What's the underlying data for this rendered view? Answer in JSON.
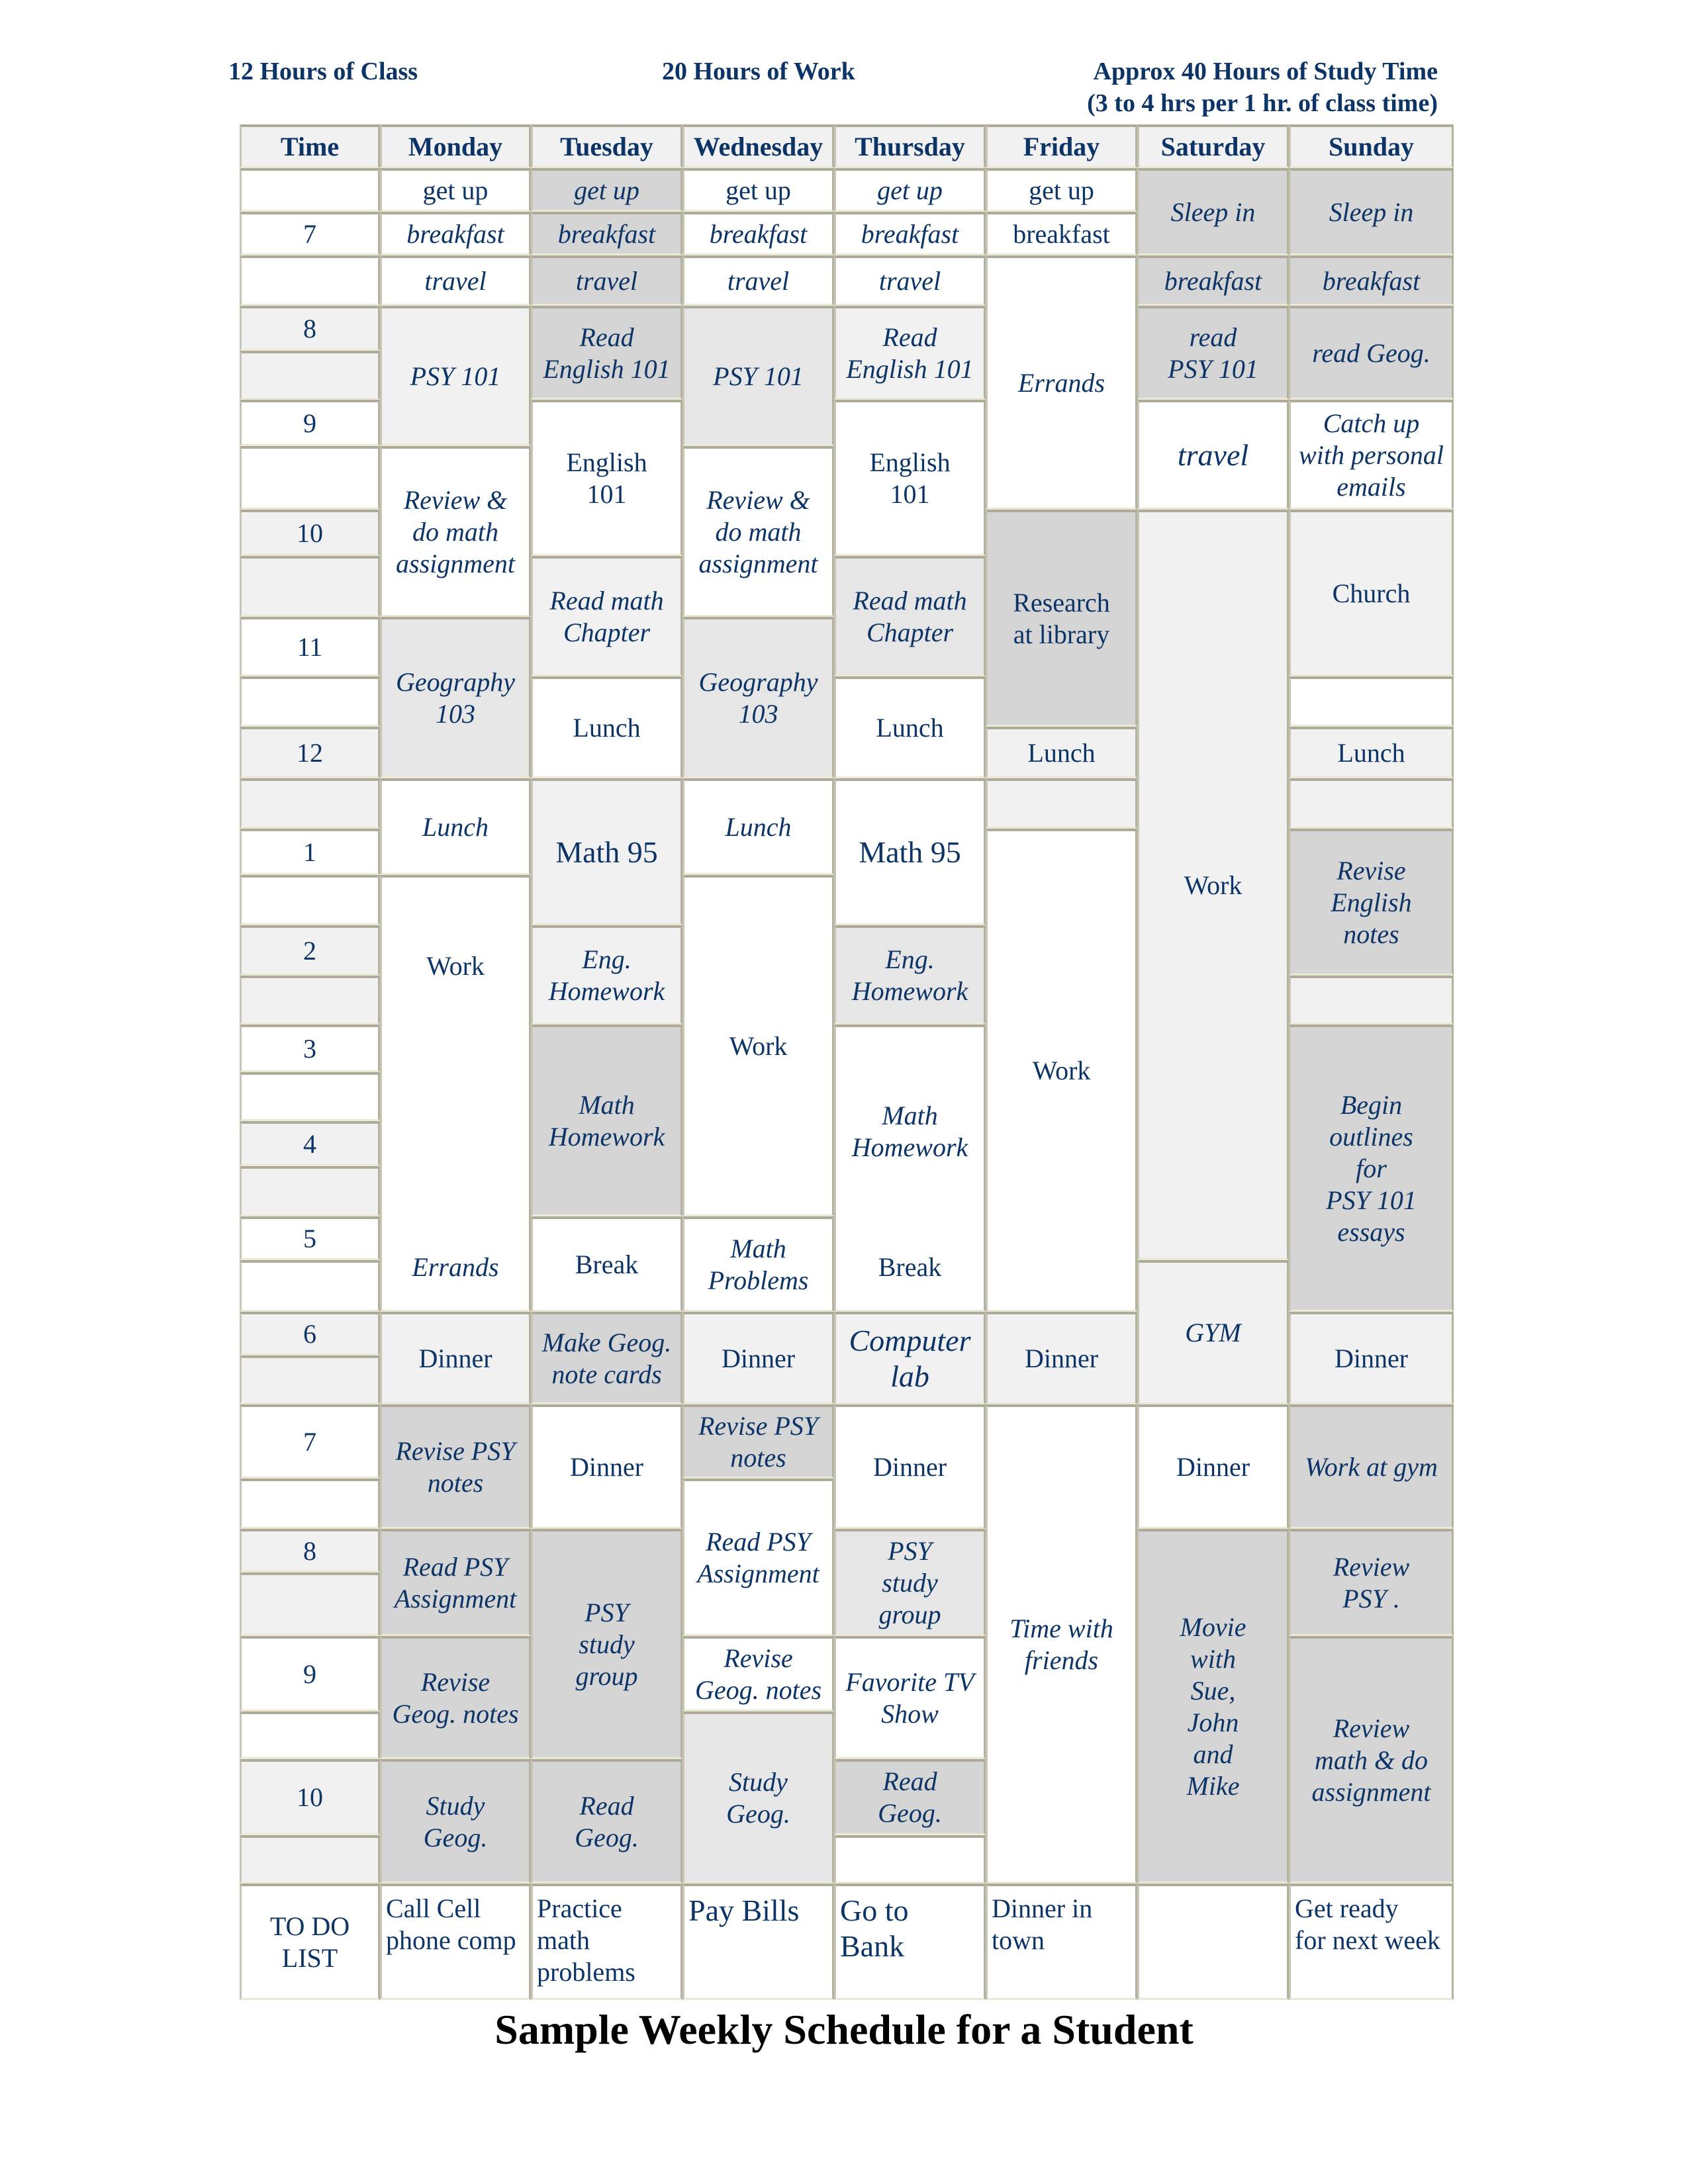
{
  "header_notes": {
    "class_hours": "12 Hours of Class",
    "work_hours": "20 Hours of Work",
    "study_hours_line1": "Approx 40 Hours of Study Time",
    "study_hours_line2": "(3 to 4 hrs per 1 hr. of class time)"
  },
  "columns": [
    "Time",
    "Monday",
    "Tuesday",
    "Wednesday",
    "Thursday",
    "Friday",
    "Saturday",
    "Sunday"
  ],
  "time_labels": [
    "",
    "7",
    "",
    "8",
    "",
    "9",
    "",
    "10",
    "",
    "11",
    "",
    "12",
    "",
    "1",
    "",
    "2",
    "",
    "3",
    "",
    "4",
    "",
    "5",
    "",
    "6",
    "",
    "7",
    "",
    "8",
    "",
    "9",
    "",
    "10",
    ""
  ],
  "time_fills": [
    "white",
    "white",
    "white",
    "light",
    "light",
    "white",
    "white",
    "light",
    "light",
    "white",
    "white",
    "light",
    "light",
    "white",
    "white",
    "light",
    "light",
    "white",
    "white",
    "light",
    "light",
    "white",
    "white",
    "light",
    "light",
    "white",
    "white",
    "light",
    "light",
    "white",
    "white",
    "light",
    "light"
  ],
  "days": [
    {
      "day": "Monday",
      "blocks": [
        {
          "start": 0,
          "span": 1,
          "text": "get up",
          "fill": "white",
          "italic": false
        },
        {
          "start": 1,
          "span": 1,
          "text": "breakfast",
          "fill": "white",
          "italic": true
        },
        {
          "start": 2,
          "span": 1,
          "text": "travel",
          "fill": "white",
          "italic": true
        },
        {
          "start": 3,
          "span": 3,
          "text": "PSY 101",
          "fill": "light",
          "italic": true
        },
        {
          "start": 6,
          "span": 3,
          "text": "Review &\ndo math\nassignment",
          "fill": "white",
          "italic": true
        },
        {
          "start": 9,
          "span": 3,
          "text": "Geography\n103",
          "fill": "mid",
          "italic": true
        },
        {
          "start": 12,
          "span": 2,
          "text": "Lunch",
          "fill": "white",
          "italic": true
        },
        {
          "start": 14,
          "span": 9,
          "text": "Work",
          "text2": "Errands",
          "fill": "white",
          "italic": false,
          "italic2": true
        },
        {
          "start": 23,
          "span": 2,
          "text": "Dinner",
          "fill": "light",
          "italic": false
        },
        {
          "start": 25,
          "span": 2,
          "text": "Revise PSY\nnotes",
          "fill": "dark",
          "italic": true
        },
        {
          "start": 27,
          "span": 2,
          "text": "Read PSY\nAssignment",
          "fill": "dark",
          "italic": true
        },
        {
          "start": 29,
          "span": 2,
          "text": "Revise\nGeog. notes",
          "fill": "dark",
          "italic": true
        },
        {
          "start": 31,
          "span": 2,
          "text": "Study\nGeog.",
          "fill": "dark",
          "italic": true
        }
      ]
    },
    {
      "day": "Tuesday",
      "blocks": [
        {
          "start": 0,
          "span": 1,
          "text": "get up",
          "fill": "dark",
          "italic": true
        },
        {
          "start": 1,
          "span": 1,
          "text": "breakfast",
          "fill": "dark",
          "italic": true
        },
        {
          "start": 2,
          "span": 1,
          "text": "travel",
          "fill": "dark",
          "italic": true
        },
        {
          "start": 3,
          "span": 2,
          "text": "Read\nEnglish 101",
          "fill": "dark",
          "italic": true
        },
        {
          "start": 5,
          "span": 3,
          "text": "English\n101",
          "fill": "white",
          "italic": false
        },
        {
          "start": 8,
          "span": 2,
          "text": "Read math\nChapter",
          "fill": "light",
          "italic": true
        },
        {
          "start": 10,
          "span": 2,
          "text": "Lunch",
          "fill": "white",
          "italic": false
        },
        {
          "start": 12,
          "span": 3,
          "text": "Math 95",
          "fill": "light",
          "italic": false,
          "big": true
        },
        {
          "start": 15,
          "span": 2,
          "text": "Eng.\nHomework",
          "fill": "light",
          "italic": true
        },
        {
          "start": 17,
          "span": 4,
          "text": "Math\nHomework",
          "fill": "dark",
          "italic": true
        },
        {
          "start": 21,
          "span": 2,
          "text": "Break",
          "fill": "white",
          "italic": false
        },
        {
          "start": 23,
          "span": 2,
          "text": "Make Geog.\nnote cards",
          "fill": "dark",
          "italic": true
        },
        {
          "start": 25,
          "span": 2,
          "text": "Dinner",
          "fill": "white",
          "italic": false
        },
        {
          "start": 27,
          "span": 4,
          "text": "PSY\nstudy\ngroup",
          "fill": "dark",
          "italic": true
        },
        {
          "start": 31,
          "span": 2,
          "text": "Read\nGeog.",
          "fill": "dark",
          "italic": true
        }
      ]
    },
    {
      "day": "Wednesday",
      "blocks": [
        {
          "start": 0,
          "span": 1,
          "text": "get up",
          "fill": "white",
          "italic": false
        },
        {
          "start": 1,
          "span": 1,
          "text": "breakfast",
          "fill": "white",
          "italic": true
        },
        {
          "start": 2,
          "span": 1,
          "text": "travel",
          "fill": "white",
          "italic": true
        },
        {
          "start": 3,
          "span": 3,
          "text": "PSY 101",
          "fill": "mid",
          "italic": true
        },
        {
          "start": 6,
          "span": 3,
          "text": "Review &\ndo math\nassignment",
          "fill": "white",
          "italic": true
        },
        {
          "start": 9,
          "span": 3,
          "text": "Geography\n103",
          "fill": "mid",
          "italic": true
        },
        {
          "start": 12,
          "span": 2,
          "text": "Lunch",
          "fill": "white",
          "italic": true
        },
        {
          "start": 14,
          "span": 7,
          "text": "Work",
          "fill": "white",
          "italic": false
        },
        {
          "start": 21,
          "span": 2,
          "text": "Math\nProblems",
          "fill": "white",
          "italic": true
        },
        {
          "start": 23,
          "span": 2,
          "text": "Dinner",
          "fill": "light",
          "italic": false
        },
        {
          "start": 25,
          "span": 1,
          "text": "Revise PSY\nnotes",
          "fill": "dark",
          "italic": true
        },
        {
          "start": 26,
          "span": 3,
          "text": "Read PSY\nAssignment",
          "fill": "white",
          "italic": true
        },
        {
          "start": 29,
          "span": 1,
          "text": "Revise\nGeog. notes",
          "fill": "white",
          "italic": true
        },
        {
          "start": 30,
          "span": 3,
          "text": "Study\nGeog.",
          "fill": "mid",
          "italic": true
        }
      ]
    },
    {
      "day": "Thursday",
      "blocks": [
        {
          "start": 0,
          "span": 1,
          "text": "get up",
          "fill": "white",
          "italic": true
        },
        {
          "start": 1,
          "span": 1,
          "text": "breakfast",
          "fill": "white",
          "italic": true
        },
        {
          "start": 2,
          "span": 1,
          "text": "travel",
          "fill": "white",
          "italic": true
        },
        {
          "start": 3,
          "span": 2,
          "text": "Read\nEnglish 101",
          "fill": "light",
          "italic": true
        },
        {
          "start": 5,
          "span": 3,
          "text": "English\n101",
          "fill": "white",
          "italic": false
        },
        {
          "start": 8,
          "span": 2,
          "text": "Read math\nChapter",
          "fill": "mid",
          "italic": true
        },
        {
          "start": 10,
          "span": 2,
          "text": "Lunch",
          "fill": "white",
          "italic": false
        },
        {
          "start": 12,
          "span": 3,
          "text": "Math 95",
          "fill": "white",
          "italic": false,
          "big": true
        },
        {
          "start": 15,
          "span": 2,
          "text": "Eng.\nHomework",
          "fill": "mid",
          "italic": true
        },
        {
          "start": 17,
          "span": 6,
          "text": "Math\nHomework",
          "text2": "Break",
          "fill": "white",
          "italic": true,
          "italic2": false
        },
        {
          "start": 23,
          "span": 2,
          "text": "Computer\nlab",
          "fill": "light",
          "italic": true,
          "big": true
        },
        {
          "start": 25,
          "span": 2,
          "text": "Dinner",
          "fill": "white",
          "italic": false
        },
        {
          "start": 27,
          "span": 2,
          "text": "PSY\nstudy\ngroup",
          "fill": "mid",
          "italic": true
        },
        {
          "start": 29,
          "span": 2,
          "text": "Favorite TV\nShow",
          "fill": "white",
          "italic": true
        },
        {
          "start": 31,
          "span": 1,
          "text": "Read\nGeog.",
          "fill": "dark",
          "italic": true
        },
        {
          "start": 32,
          "span": 1,
          "text": "",
          "fill": "white",
          "italic": false
        }
      ]
    },
    {
      "day": "Friday",
      "blocks": [
        {
          "start": 0,
          "span": 1,
          "text": "get up",
          "fill": "white",
          "italic": false
        },
        {
          "start": 1,
          "span": 1,
          "text": "breakfast",
          "fill": "white",
          "italic": false
        },
        {
          "start": 2,
          "span": 5,
          "text": "Errands",
          "fill": "white",
          "italic": true
        },
        {
          "start": 7,
          "span": 4,
          "text": "Research\nat library",
          "fill": "dark",
          "italic": false
        },
        {
          "start": 11,
          "span": 1,
          "text": "Lunch",
          "fill": "light",
          "italic": false
        },
        {
          "start": 12,
          "span": 1,
          "text": "",
          "fill": "light",
          "italic": false
        },
        {
          "start": 13,
          "span": 10,
          "text": "Work",
          "fill": "white",
          "italic": false
        },
        {
          "start": 23,
          "span": 2,
          "text": "Dinner",
          "fill": "light",
          "italic": false
        },
        {
          "start": 25,
          "span": 8,
          "text": "Time with\nfriends",
          "fill": "white",
          "italic": true
        }
      ]
    },
    {
      "day": "Saturday",
      "blocks": [
        {
          "start": 0,
          "span": 2,
          "text": "Sleep in",
          "fill": "dark",
          "italic": true
        },
        {
          "start": 2,
          "span": 1,
          "text": "breakfast",
          "fill": "dark",
          "italic": true
        },
        {
          "start": 3,
          "span": 2,
          "text": "read\nPSY 101",
          "fill": "dark",
          "italic": true
        },
        {
          "start": 5,
          "span": 2,
          "text": "travel",
          "fill": "white",
          "italic": true,
          "big": true
        },
        {
          "start": 7,
          "span": 15,
          "text": "Work",
          "fill": "light",
          "italic": false
        },
        {
          "start": 22,
          "span": 3,
          "text": "GYM",
          "fill": "light",
          "italic": true
        },
        {
          "start": 25,
          "span": 2,
          "text": "Dinner",
          "fill": "white",
          "italic": false
        },
        {
          "start": 27,
          "span": 6,
          "text": "Movie\nwith\nSue,\nJohn\nand\nMike",
          "fill": "dark",
          "italic": true
        }
      ]
    },
    {
      "day": "Sunday",
      "blocks": [
        {
          "start": 0,
          "span": 2,
          "text": "Sleep in",
          "fill": "dark",
          "italic": true
        },
        {
          "start": 2,
          "span": 1,
          "text": "breakfast",
          "fill": "dark",
          "italic": true
        },
        {
          "start": 3,
          "span": 2,
          "text": "read Geog.",
          "fill": "dark",
          "italic": true
        },
        {
          "start": 5,
          "span": 2,
          "text": "Catch up\nwith personal\nemails",
          "fill": "white",
          "italic": true
        },
        {
          "start": 7,
          "span": 3,
          "text": "Church",
          "fill": "light",
          "italic": false
        },
        {
          "start": 10,
          "span": 1,
          "text": "",
          "fill": "white",
          "italic": false
        },
        {
          "start": 11,
          "span": 1,
          "text": "Lunch",
          "fill": "light",
          "italic": false
        },
        {
          "start": 12,
          "span": 1,
          "text": "",
          "fill": "light",
          "italic": false
        },
        {
          "start": 13,
          "span": 3,
          "text": "Revise\nEnglish\nnotes",
          "fill": "dark",
          "italic": true
        },
        {
          "start": 16,
          "span": 1,
          "text": "",
          "fill": "light",
          "italic": false
        },
        {
          "start": 17,
          "span": 6,
          "text": "Begin\noutlines\nfor\nPSY 101\nessays",
          "fill": "dark",
          "italic": true
        },
        {
          "start": 23,
          "span": 2,
          "text": "Dinner",
          "fill": "light",
          "italic": false
        },
        {
          "start": 25,
          "span": 2,
          "text": "Work at gym",
          "fill": "dark",
          "italic": true
        },
        {
          "start": 27,
          "span": 2,
          "text": "Review\nPSY .",
          "fill": "dark",
          "italic": true
        },
        {
          "start": 29,
          "span": 4,
          "text": "Review\nmath & do\nassignment",
          "fill": "dark",
          "italic": true
        }
      ]
    }
  ],
  "todo": {
    "label": "TO DO\nLIST",
    "items": [
      {
        "text": "Call Cell\nphone comp",
        "big": false,
        "center": false
      },
      {
        "text": "Practice\nmath\nproblems",
        "big": false,
        "center": false
      },
      {
        "text": "Pay Bills",
        "big": true,
        "center": false
      },
      {
        "text": "Go to\nBank",
        "big": true,
        "center": false
      },
      {
        "text": "Dinner in\ntown",
        "big": false,
        "center": false
      },
      {
        "text": "",
        "big": false,
        "center": false
      },
      {
        "text": " Get ready\nfor next week",
        "big": false,
        "center": false
      }
    ]
  },
  "title": "Sample Weekly Schedule for a Student",
  "colors": {
    "text": "#0d3466",
    "fill_white": "#ffffff",
    "fill_light": "#f1f1f1",
    "fill_mid": "#e6e6e6",
    "fill_dark": "#d5d5d5"
  }
}
